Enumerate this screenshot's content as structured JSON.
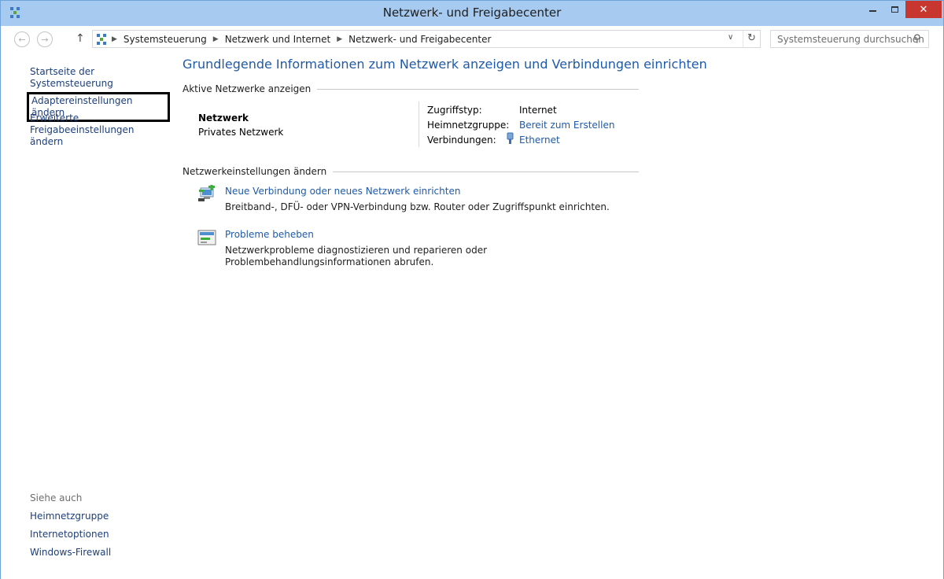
{
  "window": {
    "title": "Netzwerk- und Freigabecenter",
    "close_glyph": "✕",
    "titlebar_color": "#a6caf0",
    "close_color": "#c7372f"
  },
  "navigation": {
    "back_glyph": "←",
    "forward_glyph": "→",
    "up_glyph": "↑",
    "breadcrumbs": [
      "Systemsteuerung",
      "Netzwerk und Internet",
      "Netzwerk- und Freigabecenter"
    ],
    "separator_glyph": "▶",
    "dropdown_glyph": "∨",
    "refresh_glyph": "↻",
    "search_placeholder": "Systemsteuerung durchsuchen",
    "search_glyph": "⚲"
  },
  "left_pane": {
    "home_link": "Startseite der Systemsteuerung",
    "adapter_link": "Adaptereinstellungen ändern",
    "sharing_link_line1": "Erweiterte",
    "sharing_link_line2": "Freigabeeinstellungen ändern",
    "see_also_heading": "Siehe auch",
    "see_also": [
      "Heimnetzgruppe",
      "Internetoptionen",
      "Windows-Firewall"
    ]
  },
  "main": {
    "title": "Grundlegende Informationen zum Netzwerk anzeigen und Verbindungen einrichten",
    "active_networks_heading": "Aktive Netzwerke anzeigen",
    "network": {
      "name": "Netzwerk",
      "type": "Privates Netzwerk",
      "access_type_label": "Zugriffstyp:",
      "access_type_value": "Internet",
      "homegroup_label": "Heimnetzgruppe:",
      "homegroup_value": "Bereit zum Erstellen",
      "connections_label": "Verbindungen:",
      "connections_value": "Ethernet"
    },
    "change_settings_heading": "Netzwerkeinstellungen ändern",
    "tasks": [
      {
        "title": "Neue Verbindung oder neues Netzwerk einrichten",
        "description": "Breitband-, DFÜ- oder VPN-Verbindung bzw. Router oder Zugriffspunkt einrichten."
      },
      {
        "title": "Probleme beheben",
        "description": "Netzwerkprobleme diagnostizieren und reparieren oder Problembehandlungsinformationen abrufen."
      }
    ],
    "link_color": "#1e5aa8"
  }
}
